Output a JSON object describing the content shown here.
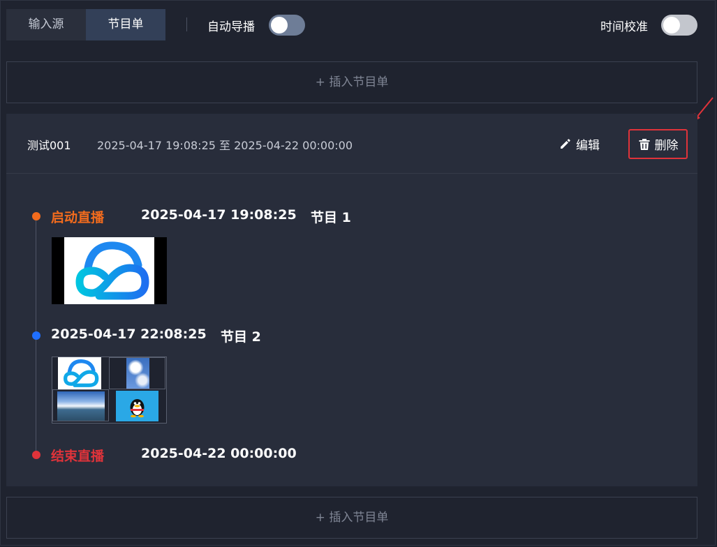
{
  "tabs": [
    {
      "label": "输入源",
      "active": false
    },
    {
      "label": "节目单",
      "active": true
    }
  ],
  "toggles": {
    "auto_director": {
      "label": "自动导播",
      "on": false
    },
    "time_calibration": {
      "label": "时间校准",
      "on": false
    }
  },
  "insert_button_label": "+ 插入节目单",
  "schedule": {
    "name": "测试001",
    "range": "2025-04-17 19:08:25 至 2025-04-22 00:00:00",
    "edit_label": "编辑",
    "delete_label": "删除",
    "start": {
      "label": "启动直播",
      "time": "2025-04-17 19:08:25",
      "program": "节目 1"
    },
    "program2": {
      "time": "2025-04-17 22:08:25",
      "program": "节目 2"
    },
    "end": {
      "label": "结束直播",
      "time": "2025-04-22 00:00:00"
    }
  },
  "colors": {
    "start": "#f26b1d",
    "program": "#1f6fff",
    "end": "#e0333a",
    "delete_highlight": "#e0333a"
  },
  "icons": {
    "edit": "pencil-icon",
    "delete": "trash-icon",
    "logo": "cloud-logo-icon",
    "qq": "penguin-icon"
  }
}
